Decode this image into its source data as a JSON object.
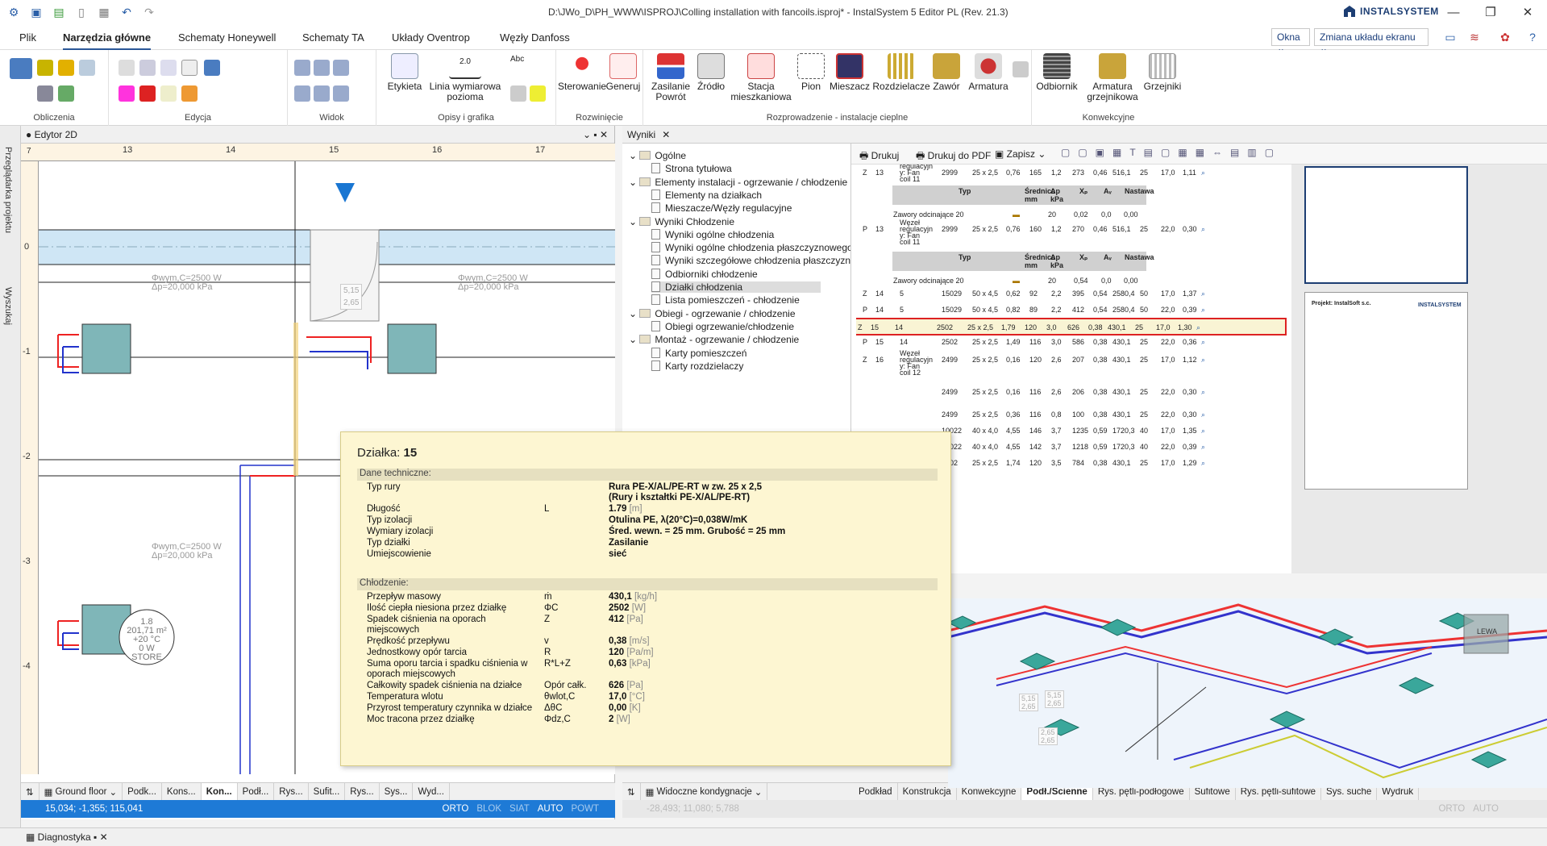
{
  "window": {
    "title": "D:\\JWo_D\\PH_WWW\\ISPROJ\\Colling installation with fancoils.isproj* - InstalSystem 5 Editor PL (Rev. 21.3)",
    "brand": "INSTALSYSTEM",
    "minimize": "—",
    "maximize": "❐",
    "close": "✕"
  },
  "ribbon": {
    "tabs": [
      "Plik",
      "Narzędzia główne",
      "Schematy Honeywell",
      "Schematy TA",
      "Układy Oventrop",
      "Węzły Danfoss"
    ],
    "right": {
      "okna": "Okna",
      "zmiana": "Zmiana układu ekranu"
    },
    "groups": [
      "Obliczenia",
      "Edycja",
      "Widok",
      "Opisy i grafika",
      "Rozwinięcie",
      "Rozprowadzenie - instalacje cieplne",
      "Konwekcyjne"
    ],
    "buttons": {
      "etykieta": "Etykieta",
      "linia": "Linia wymiarowa",
      "linia2": "pozioma",
      "sterowanie": "Sterowanie",
      "generuj": "Generuj",
      "zasilanie": "Zasilanie",
      "powrot": "Powrót",
      "zrodlo": "Źródło",
      "stacja": "Stacja",
      "stacja2": "mieszkaniowa",
      "pion": "Pion",
      "mieszacz": "Mieszacz",
      "rozdzielacze": "Rozdzielacze",
      "zawor": "Zawór",
      "armatura": "Armatura",
      "odbiornik": "Odbiornik",
      "armgrz": "Armatura",
      "armgrz2": "grzejnikowa",
      "grzejniki": "Grzejniki",
      "dim_label": "2.0",
      "abc": "Abc"
    }
  },
  "sidebar": {
    "tab1": "Przeglądarka projektu",
    "tab2": "Wyszukaj"
  },
  "editor": {
    "title": "● Edytor 2D",
    "ruler_top": [
      "13",
      "14",
      "15",
      "16",
      "17"
    ],
    "ruler_left": [
      "0",
      "-1",
      "-2",
      "-3",
      "-4"
    ],
    "ruler_corner": "7",
    "labels": [
      {
        "a": "Φwym,C=2500 W",
        "b": "Δp=20,000 kPa"
      },
      {
        "a": "Φwym,C=2500 W",
        "b": "Δp=20,000 kPa"
      },
      {
        "a": "Φwym,C=2500 W",
        "b": "Δp=20,000 kPa"
      }
    ],
    "room": {
      "a": "1.8",
      "b": "201,71 m²",
      "c": "+20 °C",
      "d": "0 W",
      "e": "STORE"
    },
    "callout": [
      "5,15",
      "2,65"
    ],
    "bottom_tabs": [
      "Ground floor",
      "Podk...",
      "Kons...",
      "Kon...",
      "Podł...",
      "Rys...",
      "Sufit...",
      "Rys...",
      "Sys...",
      "Wyd..."
    ],
    "status": {
      "coords": "15,034; -1,355; 115,041",
      "orto": "ORTO",
      "blok": "BLOK",
      "siat": "SIAT",
      "auto": "AUTO",
      "powt": "POWT"
    }
  },
  "results": {
    "title": "Wyniki",
    "tree": [
      {
        "t": "Ogólne",
        "lvl": 0
      },
      {
        "t": "Strona tytułowa",
        "lvl": 1
      },
      {
        "t": "Elementy instalacji - ogrzewanie / chłodzenie",
        "lvl": 0
      },
      {
        "t": "Elementy na działkach",
        "lvl": 1
      },
      {
        "t": "Mieszacze/Węzły regulacyjne",
        "lvl": 1
      },
      {
        "t": "Wyniki Chłodzenie",
        "lvl": 0
      },
      {
        "t": "Wyniki ogólne chłodzenia",
        "lvl": 1
      },
      {
        "t": "Wyniki ogólne chłodzenia płaszczyznowego",
        "lvl": 1
      },
      {
        "t": "Wyniki szczegółowe chłodzenia płaszczyznowego",
        "lvl": 1
      },
      {
        "t": "Odbiorniki chłodzenie",
        "lvl": 1
      },
      {
        "t": "Działki chłodzenia",
        "lvl": 1
      },
      {
        "t": "Lista pomieszczeń - chłodzenie",
        "lvl": 1
      },
      {
        "t": "Obiegi - ogrzewanie / chłodzenie",
        "lvl": 0
      },
      {
        "t": "Obiegi ogrzewanie/chłodzenie",
        "lvl": 1
      },
      {
        "t": "Montaż - ogrzewanie / chłodzenie",
        "lvl": 0
      },
      {
        "t": "Karty pomieszczeń",
        "lvl": 1
      },
      {
        "t": "Karty rozdzielaczy",
        "lvl": 1
      }
    ],
    "toolbar": {
      "print": "Drukuj",
      "pdf": "Drukuj do PDF",
      "save": "Zapisz"
    },
    "sub_headers": [
      "Typ",
      "Średnica mm",
      "Δp kPa",
      "Xₚ",
      "Aᵥ",
      "Nastawa"
    ],
    "valve_label": "Zawory odcinające 20",
    "valve_vals": [
      "20",
      "0,02",
      "0,0",
      "0,00"
    ],
    "valve_vals2": [
      "20",
      "0,54",
      "0,0",
      "0,00"
    ],
    "rows": [
      [
        "Z",
        "13",
        "regulacyjn y: Fan coil 11",
        "2999",
        "25 x 2,5",
        "0,76",
        "165",
        "1,2",
        "273",
        "0,46",
        "516,1",
        "25",
        "17,0",
        "1,11"
      ],
      [
        "P",
        "13",
        "Węzeł regulacyjn y: Fan coil 11",
        "2999",
        "25 x 2,5",
        "0,76",
        "160",
        "1,2",
        "270",
        "0,46",
        "516,1",
        "25",
        "22,0",
        "0,30"
      ],
      [
        "Z",
        "14",
        "5",
        "15029",
        "50 x 4,5",
        "0,62",
        "92",
        "2,2",
        "395",
        "0,54",
        "2580,4",
        "50",
        "17,0",
        "1,37"
      ],
      [
        "P",
        "14",
        "5",
        "15029",
        "50 x 4,5",
        "0,82",
        "89",
        "2,2",
        "412",
        "0,54",
        "2580,4",
        "50",
        "22,0",
        "0,39"
      ],
      [
        "Z",
        "15",
        "14",
        "2502",
        "25 x 2,5",
        "1,79",
        "120",
        "3,0",
        "626",
        "0,38",
        "430,1",
        "25",
        "17,0",
        "1,30"
      ],
      [
        "P",
        "15",
        "14",
        "2502",
        "25 x 2,5",
        "1,49",
        "116",
        "3,0",
        "586",
        "0,38",
        "430,1",
        "25",
        "22,0",
        "0,36"
      ],
      [
        "Z",
        "16",
        "Węzeł regulacyjn y: Fan coil 12",
        "2499",
        "25 x 2,5",
        "0,16",
        "120",
        "2,6",
        "207",
        "0,38",
        "430,1",
        "25",
        "17,0",
        "1,12"
      ],
      [
        "",
        "",
        "",
        "2499",
        "25 x 2,5",
        "0,16",
        "116",
        "2,6",
        "206",
        "0,38",
        "430,1",
        "25",
        "22,0",
        "0,30"
      ],
      [
        "",
        "",
        "",
        "2499",
        "25 x 2,5",
        "0,36",
        "116",
        "0,8",
        "100",
        "0,38",
        "430,1",
        "25",
        "22,0",
        "0,30"
      ],
      [
        "",
        "",
        "",
        "10022",
        "40 x 4,0",
        "4,55",
        "146",
        "3,7",
        "1235",
        "0,59",
        "1720,3",
        "40",
        "17,0",
        "1,35"
      ],
      [
        "",
        "",
        "",
        "10022",
        "40 x 4,0",
        "4,55",
        "142",
        "3,7",
        "1218",
        "0,59",
        "1720,3",
        "40",
        "22,0",
        "0,39"
      ],
      [
        "",
        "",
        "",
        "2502",
        "25 x 2,5",
        "1,74",
        "120",
        "3,5",
        "784",
        "0,38",
        "430,1",
        "25",
        "17,0",
        "1,29"
      ]
    ],
    "preview_title": "Projekt: InstalSoft s.c.",
    "preview_brand": "INSTALSYSTEM"
  },
  "bottom_right": {
    "left_tabs": [
      "Widoczne kondygnacje"
    ],
    "tabs": [
      "Podkład",
      "Konstrukcja",
      "Konwekcyjne",
      "Podł./Ścienne",
      "Rys. pętli-podłogowe",
      "Sufitowe",
      "Rys. pętli-sufitowe",
      "Sys. suche",
      "Wydruk"
    ],
    "status": {
      "coords": "-28,493; 11,080; 5,788",
      "orto": "ORTO",
      "auto": "AUTO"
    }
  },
  "view3d": {
    "callouts": [
      "5,15",
      "2,65",
      "5,15",
      "2,65",
      "2,65",
      "2,65"
    ],
    "box": "LEWA"
  },
  "tooltip": {
    "title_label": "Działka:",
    "title_value": "15",
    "sec1": "Dane techniczne:",
    "rows1": [
      {
        "k": "Typ rury",
        "s": "",
        "v": "Rura PE-X/AL/PE-RT w zw. 25 x 2,5",
        "v2": "(Rury i kształtki PE-X/AL/PE-RT)",
        "u": ""
      },
      {
        "k": "Długość",
        "s": "L",
        "v": "1.79",
        "u": "[m]"
      },
      {
        "k": "Typ izolacji",
        "s": "",
        "v": "Otulina PE, λ(20°C)=0,038W/mK",
        "u": ""
      },
      {
        "k": "Wymiary izolacji",
        "s": "",
        "v": "Śred. wewn. = 25 mm. Grubość = 25 mm",
        "u": ""
      },
      {
        "k": "Typ działki",
        "s": "",
        "v": "Zasilanie",
        "u": ""
      },
      {
        "k": "Umiejscowienie",
        "s": "",
        "v": "sieć",
        "u": ""
      }
    ],
    "sec2": "Chłodzenie:",
    "rows2": [
      {
        "k": "Przepływ masowy",
        "s": "ṁ",
        "v": "430,1",
        "u": "[kg/h]"
      },
      {
        "k": "Ilość ciepła niesiona przez działkę",
        "s": "ΦC",
        "v": "2502",
        "u": "[W]"
      },
      {
        "k": "Spadek ciśnienia na oporach",
        "k2": "miejscowych",
        "s": "Z",
        "v": "412",
        "u": "[Pa]"
      },
      {
        "k": "Prędkość przepływu",
        "s": "v",
        "v": "0,38",
        "u": "[m/s]"
      },
      {
        "k": "Jednostkowy opór tarcia",
        "s": "R",
        "v": "120",
        "u": "[Pa/m]"
      },
      {
        "k": "Suma oporu tarcia i spadku ciśnienia w",
        "k2": "oporach miejscowych",
        "s": "R*L+Z",
        "v": "0,63",
        "u": "[kPa]"
      },
      {
        "k": "Całkowity spadek ciśnienia na działce",
        "s": "Opór całk.",
        "v": "626",
        "u": "[Pa]"
      },
      {
        "k": "Temperatura wlotu",
        "s": "θwlot,C",
        "v": "17,0",
        "u": "[°C]"
      },
      {
        "k": "Przyrost temperatury czynnika w działce",
        "s": "ΔθC",
        "v": "0,00",
        "u": "[K]"
      },
      {
        "k": "Moc tracona przez działkę",
        "s": "Φdz,C",
        "v": "2",
        "u": "[W]"
      }
    ]
  },
  "diagnostics": {
    "label": "Diagnostyka"
  }
}
